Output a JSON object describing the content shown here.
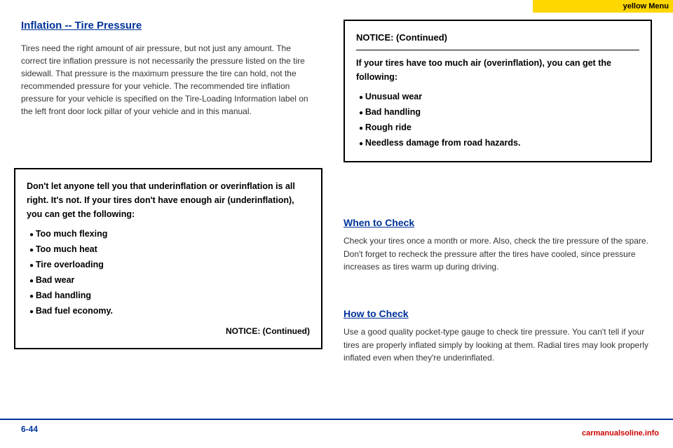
{
  "topBar": {
    "text": "yellow Menu"
  },
  "sectionTitle": "Inflation -- Tire Pressure",
  "leftBodyText": "Tires need the right amount of air pressure, but not just any amount. The correct tire inflation pressure is not necessarily the pressure listed on the tire sidewall. That pressure is the maximum pressure the tire can hold, not the recommended pressure for your vehicle. The recommended tire inflation pressure for your vehicle is specified on the Tire-Loading Information label on the left front door lock pillar of your vehicle and in this manual.",
  "noticeBoxLeft": {
    "intro": "Don't let anyone tell you that underinflation or overinflation is all right. It's not. If your tires don't have enough air (underinflation), you can get the following:",
    "items": [
      "Too much flexing",
      "Too much heat",
      "Tire overloading",
      "Bad wear",
      "Bad handling",
      "Bad fuel economy."
    ],
    "continued": "NOTICE: (Continued)"
  },
  "noticeBoxRight": {
    "title": "NOTICE: (Continued)",
    "body": "If your tires have too much air (overinflation), you can get the following:",
    "items": [
      "Unusual wear",
      "Bad handling",
      "Rough ride",
      "Needless damage from road hazards."
    ]
  },
  "whenToCheck": {
    "heading": "When to Check",
    "body": "Check your tires once a month or more. Also, check the tire pressure of the spare. Don't forget to recheck the pressure after the tires have cooled, since pressure increases as tires warm up during driving."
  },
  "howToCheck": {
    "heading": "How to Check",
    "body": "Use a good quality pocket-type gauge to check tire pressure. You can't tell if your tires are properly inflated simply by looking at them. Radial tires may look properly inflated even when they're underinflated."
  },
  "bottomPage": "6-44",
  "bottomLogo": "carmanualsoline.info"
}
